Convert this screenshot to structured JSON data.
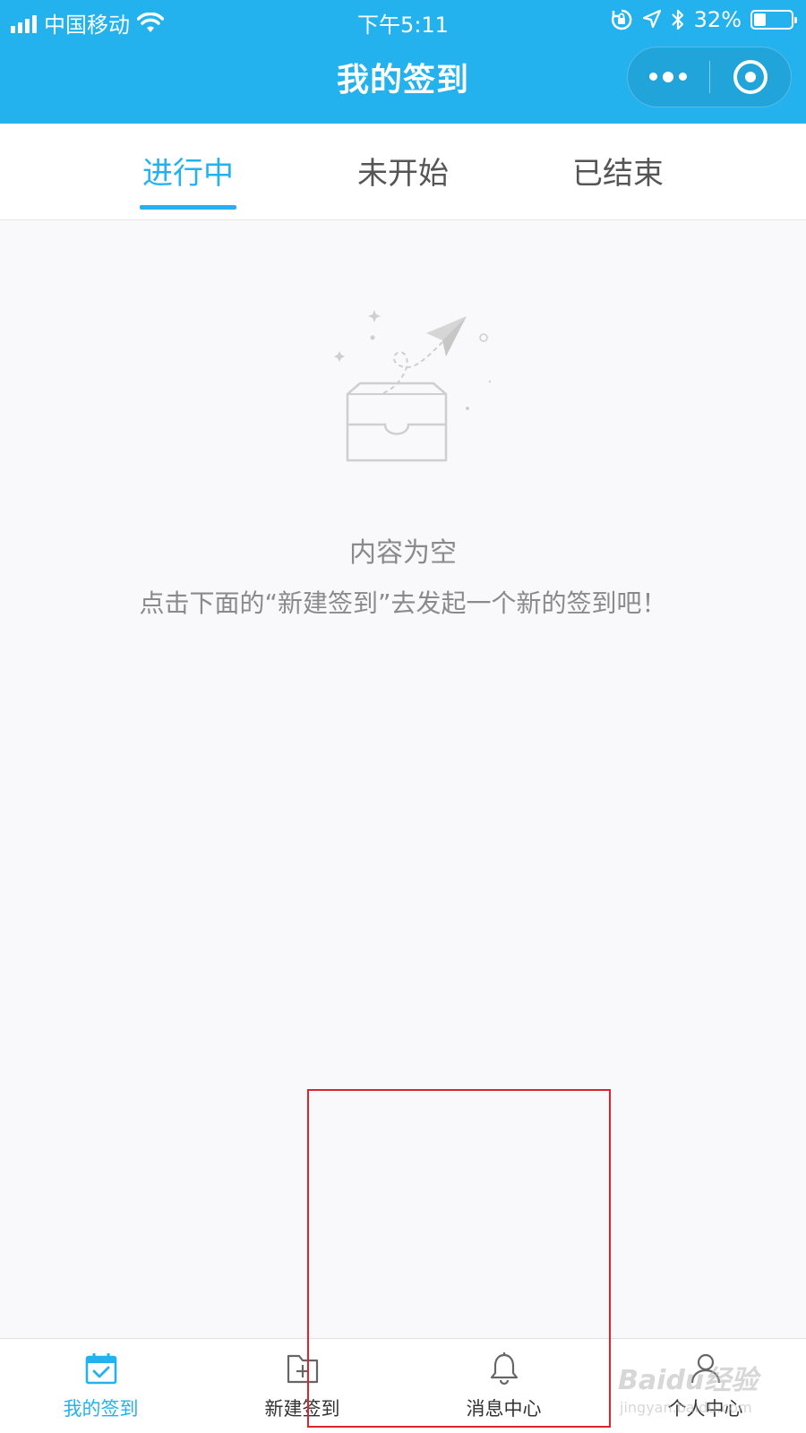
{
  "status_bar": {
    "carrier": "中国移动",
    "time": "下午5:11",
    "battery": "32%",
    "battery_level": 0.32,
    "icons": [
      "signal-icon",
      "wifi-icon",
      "orientation-lock-icon",
      "location-icon",
      "bluetooth-icon",
      "battery-icon"
    ]
  },
  "nav": {
    "title": "我的签到",
    "menu_icon": "more-dots-icon",
    "close_icon": "miniprogram-close-icon"
  },
  "tabs": [
    {
      "label": "进行中",
      "active": true
    },
    {
      "label": "未开始",
      "active": false
    },
    {
      "label": "已结束",
      "active": false
    }
  ],
  "empty_state": {
    "icon": "empty-inbox-paper-plane-icon",
    "title": "内容为空",
    "description": "点击下面的“新建签到”去发起一个新的签到吧！"
  },
  "tabbar": {
    "items": [
      {
        "label": "我的签到",
        "icon": "calendar-check-icon",
        "active": true
      },
      {
        "label": "新建签到",
        "icon": "folder-plus-icon",
        "active": false
      },
      {
        "label": "消息中心",
        "icon": "bell-icon",
        "active": false
      },
      {
        "label": "个人中心",
        "icon": "user-icon",
        "active": false
      }
    ]
  },
  "watermark": {
    "logo": "Baidu经验",
    "url": "jingyan.baidu.com"
  },
  "colors": {
    "accent": "#23b2ed",
    "highlight_box": "#d9262c",
    "muted_text": "#8a8a8a",
    "background": "#f9f8fa"
  }
}
